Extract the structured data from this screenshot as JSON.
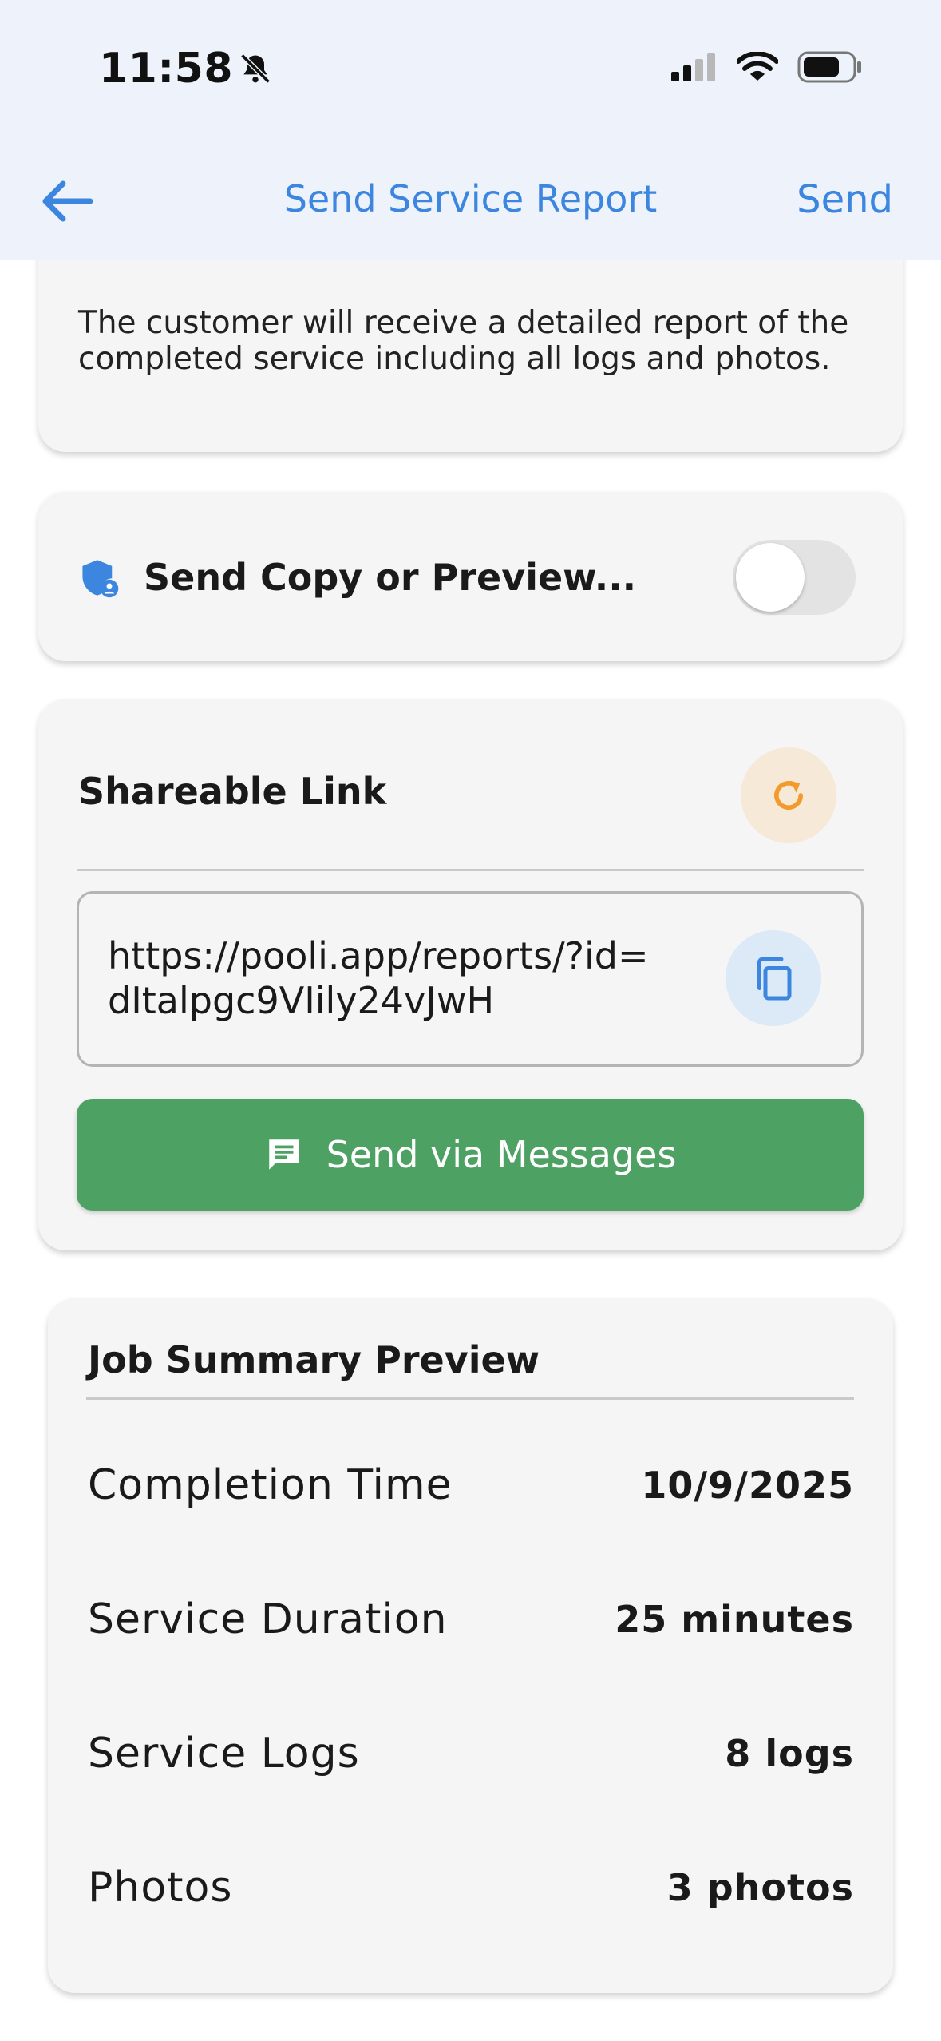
{
  "status_bar": {
    "time": "11:58"
  },
  "nav": {
    "title": "Send Service Report",
    "send_label": "Send"
  },
  "intro": {
    "text": "The customer will receive a detailed report of the completed service including all logs and photos."
  },
  "copy_preview": {
    "label": "Send Copy or Preview...",
    "enabled": false
  },
  "shareable_link": {
    "title": "Shareable Link",
    "url": "https://pooli.app/reports/?id=dItalpgc9VIily24vJwH",
    "messages_label": "Send via Messages"
  },
  "summary": {
    "title": "Job Summary Preview",
    "rows": [
      {
        "label": "Completion Time",
        "value": "10/9/2025"
      },
      {
        "label": "Service Duration",
        "value": "25 minutes"
      },
      {
        "label": "Service Logs",
        "value": "8 logs"
      },
      {
        "label": "Photos",
        "value": "3 photos"
      }
    ]
  },
  "colors": {
    "accent": "#3d86e0",
    "topbar_bg": "#eef3fb",
    "card_bg": "#f5f5f5",
    "messages_green": "#4ca163",
    "refresh_orange": "#f29b2c"
  },
  "icons": {
    "status_mute": "bell-slash-icon",
    "status_signal": "cellular-signal-icon",
    "status_wifi": "wifi-icon",
    "status_battery": "battery-icon",
    "back": "arrow-left-icon",
    "copy_preview": "shield-person-icon",
    "refresh": "refresh-icon",
    "copy": "copy-icon",
    "messages": "message-icon"
  }
}
